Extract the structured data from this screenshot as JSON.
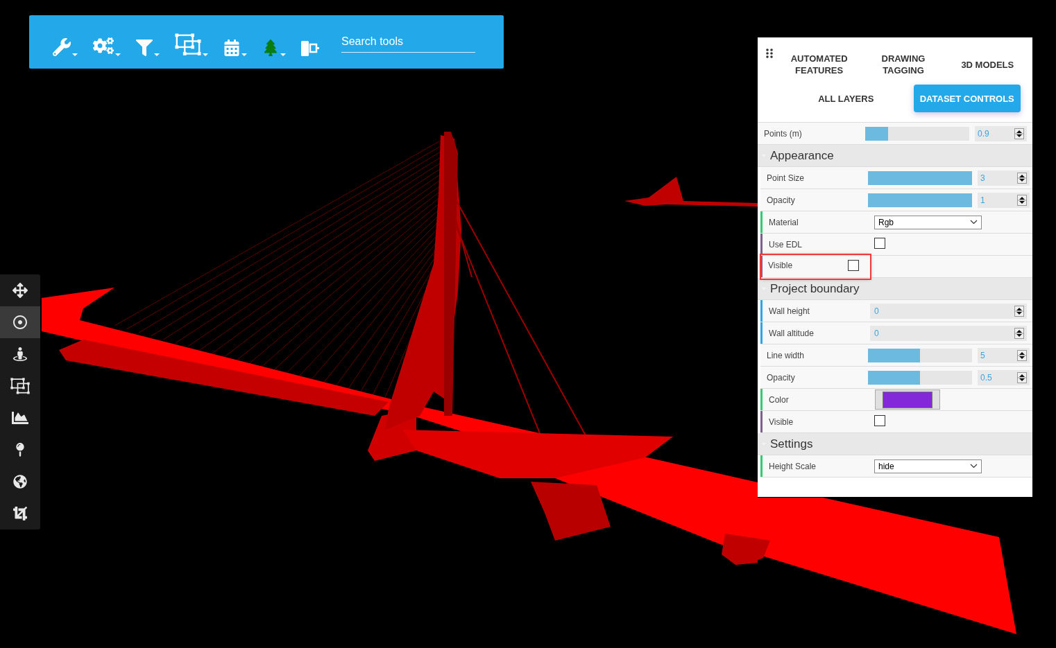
{
  "toolbar": {
    "tools": [
      {
        "dropdown": true
      },
      {
        "dropdown": true
      },
      {
        "dropdown": true
      },
      {
        "dropdown": true
      },
      {
        "dropdown": true
      },
      {
        "dropdown": true
      },
      {
        "dropdown": false
      }
    ],
    "search": {
      "placeholder": "Search tools"
    }
  },
  "side_nav": [
    {
      "selected": false
    },
    {
      "selected": true
    },
    {
      "selected": false
    },
    {
      "selected": false
    },
    {
      "selected": false
    },
    {
      "selected": false
    },
    {
      "selected": false
    },
    {
      "selected": false
    }
  ],
  "panel": {
    "tab_rows": [
      [
        {
          "label": "AUTOMATED FEATURES",
          "selected": false
        },
        {
          "label": "DRAWING TAGGING",
          "selected": false
        },
        {
          "label": "3D MODELS",
          "selected": false
        }
      ],
      [
        {
          "label": "ALL LAYERS",
          "selected": false
        },
        {
          "label": "DATASET CONTROLS",
          "selected": true
        }
      ]
    ],
    "top_rows": [
      {
        "kind": "slider",
        "label": "Points (m)",
        "level": 0.22,
        "value": "0.9",
        "highlighted": false
      }
    ],
    "sections": [
      {
        "title": "Appearance",
        "expanded": true,
        "rows": [
          {
            "kind": "slider",
            "label": "Point Size",
            "level": 1,
            "value": "3",
            "highlighted": false
          },
          {
            "kind": "slider",
            "label": "Opacity",
            "level": 1,
            "value": "1",
            "highlighted": false
          },
          {
            "kind": "select",
            "label": "Material",
            "value": "Rgb",
            "highlighted": false
          },
          {
            "kind": "checkbox",
            "label": "Use EDL",
            "checked": false,
            "highlighted": false
          },
          {
            "kind": "checkbox",
            "label": "Visible",
            "checked": false,
            "highlighted": true
          }
        ]
      },
      {
        "title": "Project boundary",
        "expanded": true,
        "rows": [
          {
            "kind": "number",
            "label": "Wall height",
            "value": "0",
            "highlighted": false
          },
          {
            "kind": "number",
            "label": "Wall altitude",
            "value": "0",
            "highlighted": false
          },
          {
            "kind": "slider",
            "label": "Line width",
            "level": 0.5,
            "value": "5",
            "highlighted": false
          },
          {
            "kind": "slider",
            "label": "Opacity",
            "level": 0.5,
            "value": "0.5",
            "highlighted": false
          },
          {
            "kind": "color",
            "label": "Color",
            "color": "#8429d9",
            "highlighted": false
          },
          {
            "kind": "checkbox",
            "label": "Visible",
            "checked": false,
            "highlighted": false
          }
        ]
      },
      {
        "title": "Settings",
        "expanded": true,
        "rows": [
          {
            "kind": "select",
            "label": "Height Scale",
            "value": "hide",
            "highlighted": false
          }
        ]
      }
    ]
  }
}
